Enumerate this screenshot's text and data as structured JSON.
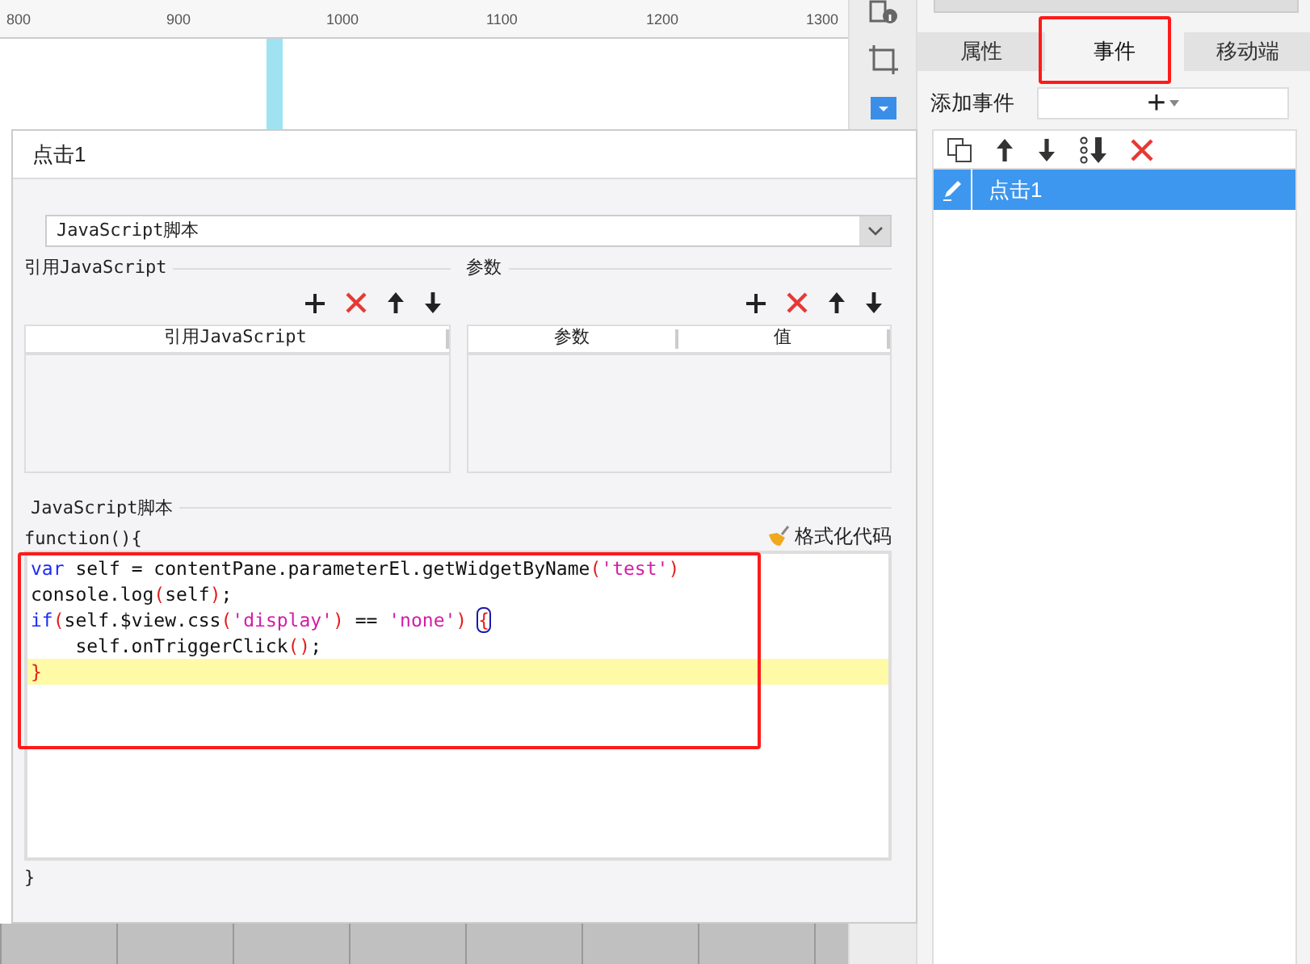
{
  "ruler": {
    "labels": [
      "800",
      "900",
      "1000",
      "1100",
      "1200",
      "1300"
    ]
  },
  "dialog": {
    "title": "点击1",
    "type_select": {
      "value": "JavaScript脚本"
    },
    "imports": {
      "legend": "引用JavaScript",
      "columns": [
        "引用JavaScript"
      ]
    },
    "params": {
      "legend": "参数",
      "columns": [
        "参数",
        "值"
      ]
    },
    "script": {
      "legend": "JavaScript脚本",
      "header": "function(){",
      "format_button": "格式化代码",
      "footer": "}",
      "lines": [
        {
          "current": false,
          "tokens": [
            {
              "kind": "keyword",
              "text": "var"
            },
            {
              "kind": "plain",
              "text": " self = contentPane.parameterEl.getWidgetByName"
            },
            {
              "kind": "paren",
              "text": "("
            },
            {
              "kind": "string",
              "text": "'test'"
            },
            {
              "kind": "paren",
              "text": ")"
            }
          ]
        },
        {
          "current": false,
          "tokens": [
            {
              "kind": "plain",
              "text": "console.log"
            },
            {
              "kind": "paren",
              "text": "("
            },
            {
              "kind": "plain",
              "text": "self"
            },
            {
              "kind": "paren",
              "text": ")"
            },
            {
              "kind": "plain",
              "text": ";"
            }
          ]
        },
        {
          "current": false,
          "tokens": [
            {
              "kind": "keyword",
              "text": "if"
            },
            {
              "kind": "paren",
              "text": "("
            },
            {
              "kind": "plain",
              "text": "self.$view.css"
            },
            {
              "kind": "paren",
              "text": "("
            },
            {
              "kind": "string",
              "text": "'display'"
            },
            {
              "kind": "paren",
              "text": ")"
            },
            {
              "kind": "plain",
              "text": " == "
            },
            {
              "kind": "string",
              "text": "'none'"
            },
            {
              "kind": "paren",
              "text": ")"
            },
            {
              "kind": "matched",
              "text": "{"
            }
          ]
        },
        {
          "current": false,
          "tokens": [
            {
              "kind": "plain",
              "text": "    self.onTriggerClick"
            },
            {
              "kind": "paren",
              "text": "()"
            },
            {
              "kind": "plain",
              "text": ";"
            }
          ]
        },
        {
          "current": true,
          "tokens": [
            {
              "kind": "paren",
              "text": "}"
            }
          ]
        }
      ]
    }
  },
  "panel": {
    "tabs": [
      {
        "label": "属性",
        "selected": false
      },
      {
        "label": "事件",
        "selected": true
      },
      {
        "label": "移动端",
        "selected": false
      }
    ],
    "add_event_label": "添加事件",
    "add_button": "+",
    "events": [
      {
        "label": "点击1",
        "selected": true
      }
    ]
  }
}
